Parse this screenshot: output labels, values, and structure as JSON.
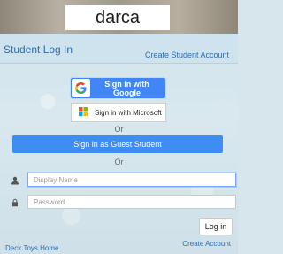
{
  "brand": {
    "name": "darca"
  },
  "header": {
    "title": "Student Log In",
    "create_link": "Create Student Account"
  },
  "auth": {
    "google_label": "Sign in with Google",
    "microsoft_label": "Sign in with Microsoft",
    "or1": "Or",
    "guest_label": "Sign in as Guest Student",
    "or2": "Or"
  },
  "form": {
    "display_name_placeholder": "Display Name",
    "display_name_value": "",
    "password_placeholder": "Password",
    "password_value": "",
    "login_label": "Log in"
  },
  "footer": {
    "home_link": "Deck.Toys Home",
    "create_account": "Create Account"
  },
  "icons": {
    "google": "google-g-icon",
    "microsoft": "microsoft-logo-icon",
    "user": "user-icon",
    "lock": "lock-icon"
  },
  "colors": {
    "google_blue": "#4285f4",
    "guest_blue": "#3f8cf2",
    "link_blue": "#2a6db0"
  }
}
